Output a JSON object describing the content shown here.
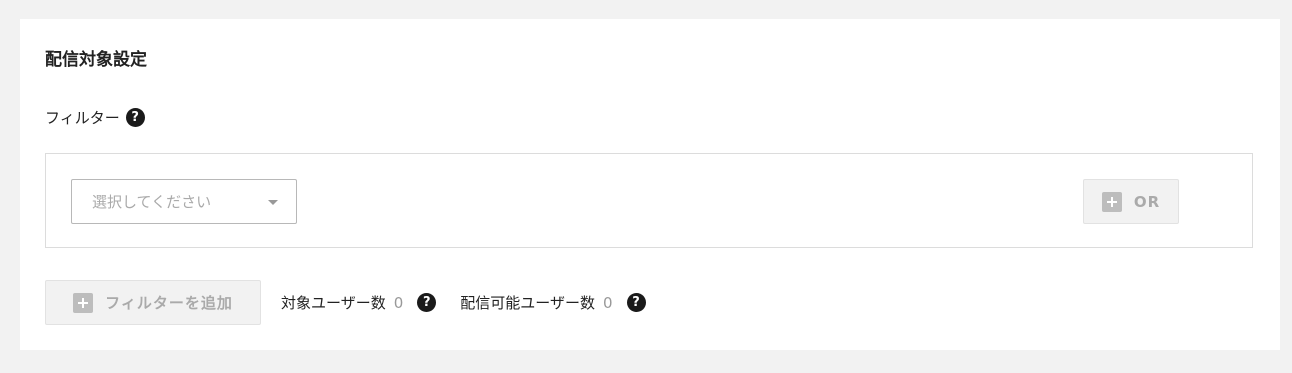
{
  "section": {
    "title": "配信対象設定"
  },
  "filter": {
    "label": "フィルター",
    "help_icon": "?",
    "select_placeholder": "選択してください",
    "or_button_label": "OR"
  },
  "footer": {
    "add_filter_label": "フィルターを追加",
    "target_users_label": "対象ユーザー数",
    "target_users_count": "0",
    "deliverable_users_label": "配信可能ユーザー数",
    "deliverable_users_count": "0",
    "help_icon": "?"
  },
  "icons": {
    "help": "question-circle-icon",
    "plus": "plus-square-icon",
    "caret": "caret-down-icon"
  },
  "colors": {
    "background": "#f2f2f2",
    "panel": "#ffffff",
    "muted_text": "#aaaaaa",
    "help_icon_bg": "#1a1a1a"
  }
}
